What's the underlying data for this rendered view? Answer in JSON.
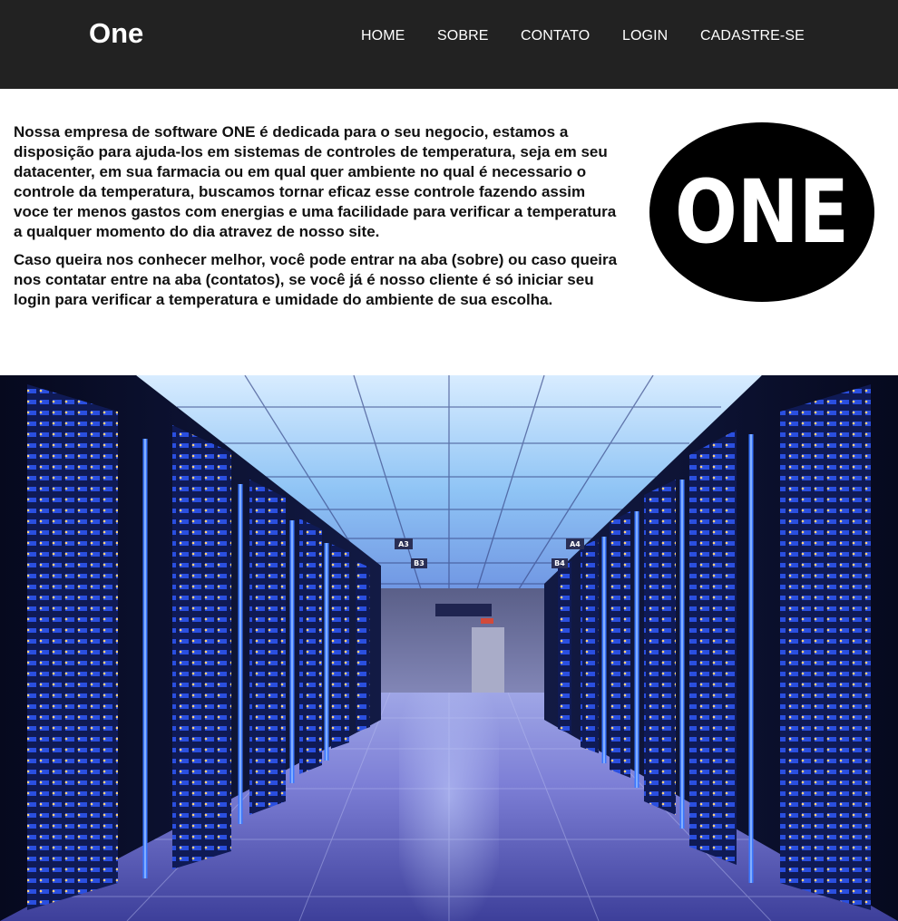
{
  "header": {
    "brand": "One",
    "nav": [
      {
        "label": "HOME"
      },
      {
        "label": "SOBRE"
      },
      {
        "label": "CONTATO"
      },
      {
        "label": "LOGIN"
      },
      {
        "label": "CADASTRE-SE"
      }
    ]
  },
  "intro": {
    "p1_before": "Nossa empresa de software ",
    "p1_brand": "ONE",
    "p1_after": " é dedicada para o seu negocio, estamos a disposição para ajuda-los em sistemas de controles de temperatura, seja em seu datacenter, em sua farmacia ou em qual quer ambiente no qual é necessario o controle da temperatura, buscamos tornar eficaz esse controle fazendo assim voce ter menos gastos com energias e uma facilidade para verificar a temperatura a qualquer momento do dia atravez de nosso site.",
    "p2": "Caso queira nos conhecer melhor, você pode entrar na aba (sobre) ou caso queira nos contatar entre na aba (contatos), se você já é nosso cliente é só iniciar seu login para verificar a temperatura e umidade do ambiente de sua escolha."
  },
  "logo": {
    "text": "ONE",
    "icon": "one-logo-icon"
  },
  "hero": {
    "icon": "datacenter-corridor-image",
    "signs": [
      "A3",
      "A4",
      "B3",
      "B4"
    ]
  },
  "colors": {
    "header_bg": "#222222",
    "header_text": "#ffffff",
    "body_text": "#111111",
    "logo_bg": "#000000",
    "hero_accent": "#3a6bff"
  }
}
